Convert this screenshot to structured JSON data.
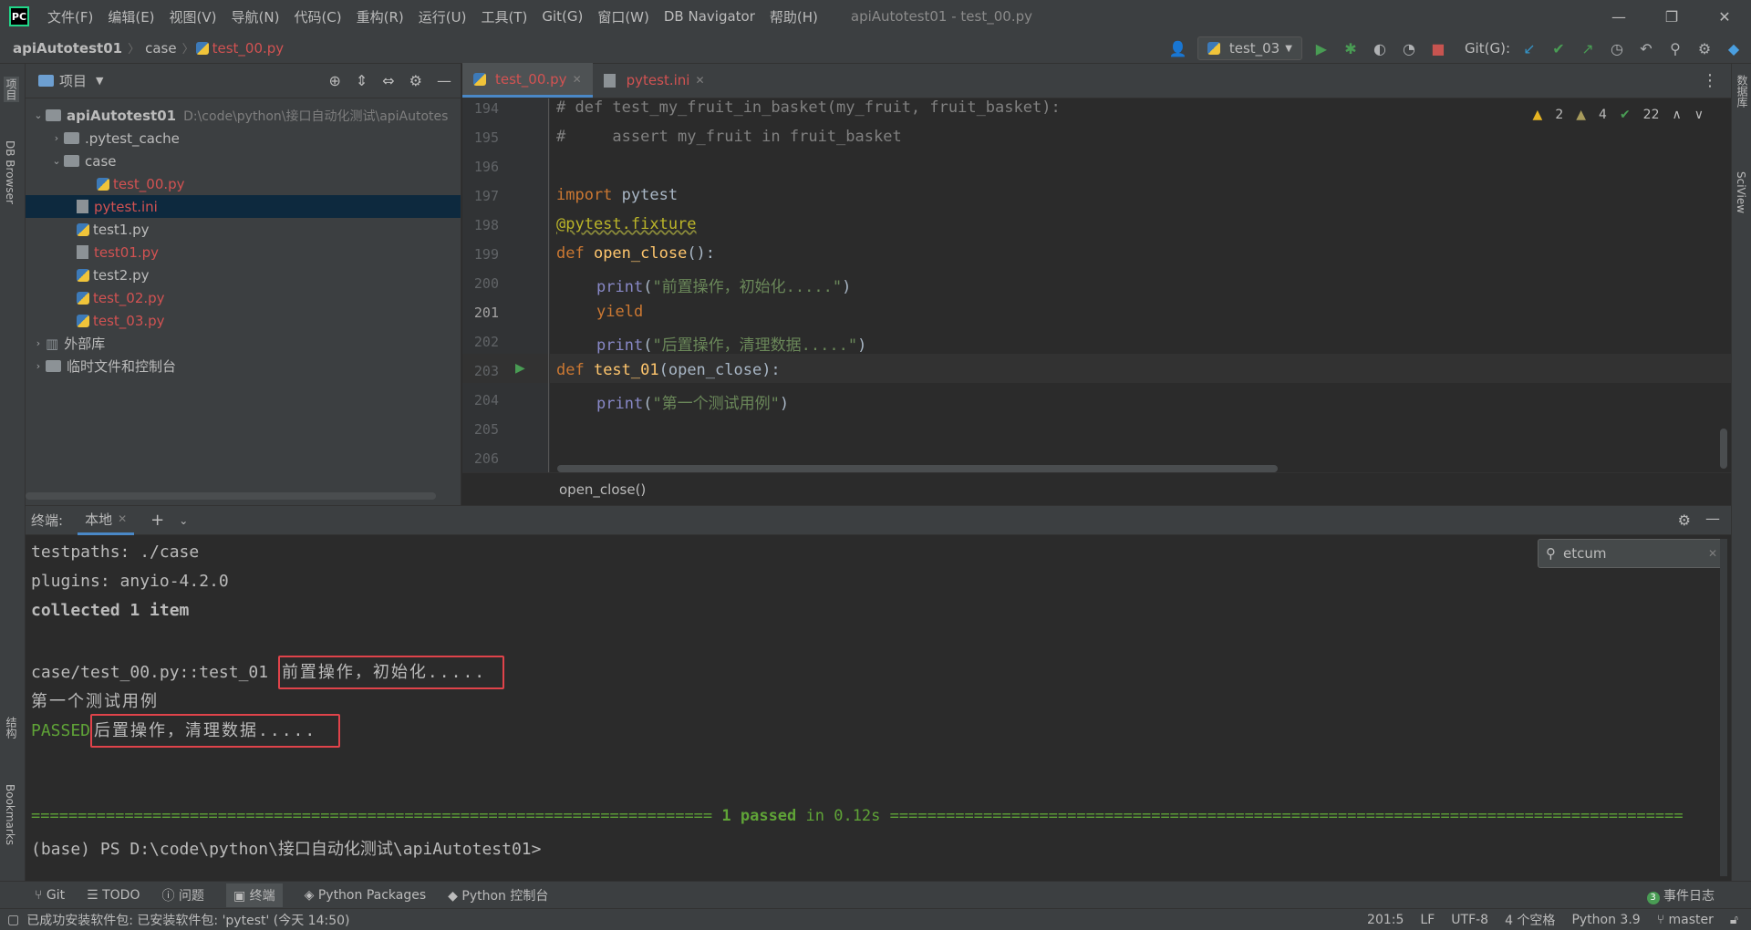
{
  "menubar": {
    "items": [
      "文件(F)",
      "编辑(E)",
      "视图(V)",
      "导航(N)",
      "代码(C)",
      "重构(R)",
      "运行(U)",
      "工具(T)",
      "Git(G)",
      "窗口(W)",
      "DB Navigator",
      "帮助(H)"
    ],
    "window_title": "apiAutotest01 - test_00.py"
  },
  "navbar": {
    "crumbs": [
      "apiAutotest01",
      "case",
      "test_00.py"
    ],
    "run_config": "test_03",
    "git_label": "Git(G):"
  },
  "left_strip": {
    "project": "项目",
    "db_browser": "DB Browser",
    "structure": "结构",
    "bookmarks": "Bookmarks"
  },
  "right_strip": {
    "database": "数据库",
    "sciview": "SciView"
  },
  "project": {
    "title": "项目",
    "root_name": "apiAutotest01",
    "root_path": "D:\\code\\python\\接口自动化测试\\apiAutotes",
    "items": [
      ".pytest_cache",
      "case",
      "test_00.py",
      "pytest.ini",
      "test1.py",
      "test01.py",
      "test2.py",
      "test_02.py",
      "test_03.py",
      "外部库",
      "临时文件和控制台"
    ]
  },
  "editor": {
    "tabs": [
      "test_00.py",
      "pytest.ini"
    ],
    "inspections": {
      "warnings": "2",
      "weak_warnings": "4",
      "ok": "22"
    },
    "line_numbers": [
      "194",
      "195",
      "196",
      "197",
      "198",
      "199",
      "200",
      "201",
      "202",
      "203",
      "204",
      "205",
      "206"
    ],
    "code": {
      "l194": "# def test_my_fruit_in_basket(my_fruit, fruit_basket):",
      "l195": "#     assert my_fruit in fruit_basket",
      "l197_kw": "import",
      "l197_mod": " pytest",
      "l198": "@pytest.fixture",
      "l199_kw": "def",
      "l199_fn": " open_close",
      "l199_rest": "():",
      "l200_fn": "print",
      "l200_str": "\"前置操作，初始化.....\"",
      "l201": "yield",
      "l202_fn": "print",
      "l202_str": "\"后置操作，清理数据.....\"",
      "l203_kw": "def",
      "l203_fn": " test_01",
      "l203_rest": "(open_close):",
      "l204_fn": "print",
      "l204_str": "\"第一个测试用例\""
    },
    "breadcrumb": "open_close()"
  },
  "terminal": {
    "label": "终端:",
    "tab": "本地",
    "search": "etcum",
    "lines": {
      "testpaths": "testpaths: ./case",
      "plugins": "plugins: anyio-4.2.0",
      "collected": "collected 1 item",
      "case": "case/test_00.py::test_01 ",
      "pre": "前置操作，初始化.....",
      "case1": "第一个测试用例",
      "passed": "PASSED",
      "post": "后置操作，清理数据.....",
      "sep_left": "========================================================================= ",
      "summary": "1 passed",
      "summary_time": " in 0.12s",
      "sep_right": " =====================================================================================",
      "prompt": "(base) PS D:\\code\\python\\接口自动化测试\\apiAutotest01>"
    }
  },
  "bottom_tabs": [
    "Git",
    "TODO",
    "问题",
    "终端",
    "Python Packages",
    "Python 控制台"
  ],
  "event_log": {
    "count": "3",
    "label": "事件日志"
  },
  "status": {
    "message": "已成功安装软件包: 已安装软件包: 'pytest' (今天 14:50)",
    "position": "201:5",
    "line_sep": "LF",
    "encoding": "UTF-8",
    "indent": "4 个空格",
    "interpreter": "Python 3.9",
    "branch": "master"
  }
}
